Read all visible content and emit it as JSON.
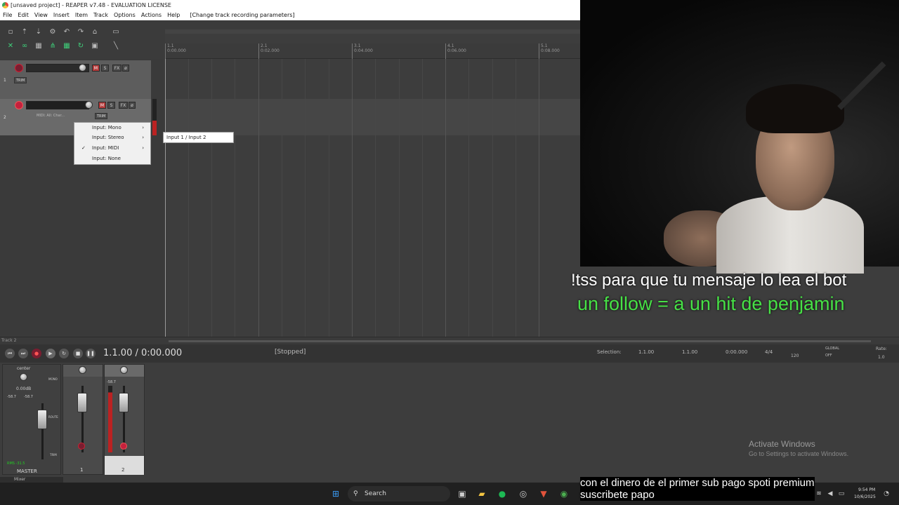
{
  "window": {
    "title": "[unsaved project] - REAPER v7.48 - EVALUATION LICENSE"
  },
  "menu": [
    "File",
    "Edit",
    "View",
    "Insert",
    "Item",
    "Track",
    "Options",
    "Actions",
    "Help",
    "[Change track recording parameters]"
  ],
  "ruler": [
    {
      "bar": "1.1",
      "time": "0:00.000"
    },
    {
      "bar": "2.1",
      "time": "0:02.000"
    },
    {
      "bar": "3.1",
      "time": "0:04.000"
    },
    {
      "bar": "4.1",
      "time": "0:06.000"
    },
    {
      "bar": "5.1",
      "time": "0:08.000"
    }
  ],
  "tracks": [
    {
      "number": "1",
      "trim": "TRIM",
      "m": "M",
      "s": "S",
      "fx": "FX"
    },
    {
      "number": "2",
      "trim": "TRIM",
      "m": "M",
      "s": "S",
      "fx": "FX",
      "input": "MIDI: All: Char..."
    }
  ],
  "context_menu": {
    "items": [
      {
        "label": "Input: Mono",
        "checked": false,
        "submenu": true
      },
      {
        "label": "Input: Stereo",
        "checked": false,
        "submenu": true
      },
      {
        "label": "Input: MIDI",
        "checked": true,
        "submenu": true
      },
      {
        "label": "Input: None",
        "checked": false,
        "submenu": false
      }
    ],
    "check": "✓",
    "arrow": "›",
    "submenu_item": "Input 1 / Input 2"
  },
  "status_track": "Track 2",
  "transport": {
    "position": "1.1.00 / 0:00.000",
    "state": "[Stopped]",
    "selection_label": "Selection:",
    "sel_start": "1.1.00",
    "sel_end": "1.1.00",
    "sel_len": "0:00.000",
    "time_sig": "4/4",
    "tempo": "120",
    "global": "GLOBAL",
    "off": "OFF",
    "rate_label": "Rate:",
    "rate": "1.0"
  },
  "mixer": {
    "master_label": "MASTER",
    "center": "center",
    "db": "0.00dB",
    "peaks": [
      "-58.7",
      "-58.7"
    ],
    "rms": "RMS -31.5",
    "mono": "MONO",
    "route": "ROUTE",
    "trim": "TRIM",
    "strip_numbers": [
      "1",
      "2"
    ],
    "track2_peak": "-58.7",
    "mixer_tab": "Mixer"
  },
  "overlay": {
    "line1": "!tss para que tu mensaje lo lea el bot",
    "line2": "un follow = a un hit de penjamin",
    "line3a": "con el dinero de el primer sub pago spoti premium",
    "line3b": "suscribete papo",
    "line2_color": "#47e046"
  },
  "activate": {
    "title": "Activate Windows",
    "sub": "Go to Settings to activate Windows."
  },
  "taskbar": {
    "search": "Search",
    "time": "9:54 PM",
    "date": "10/6/2025"
  }
}
